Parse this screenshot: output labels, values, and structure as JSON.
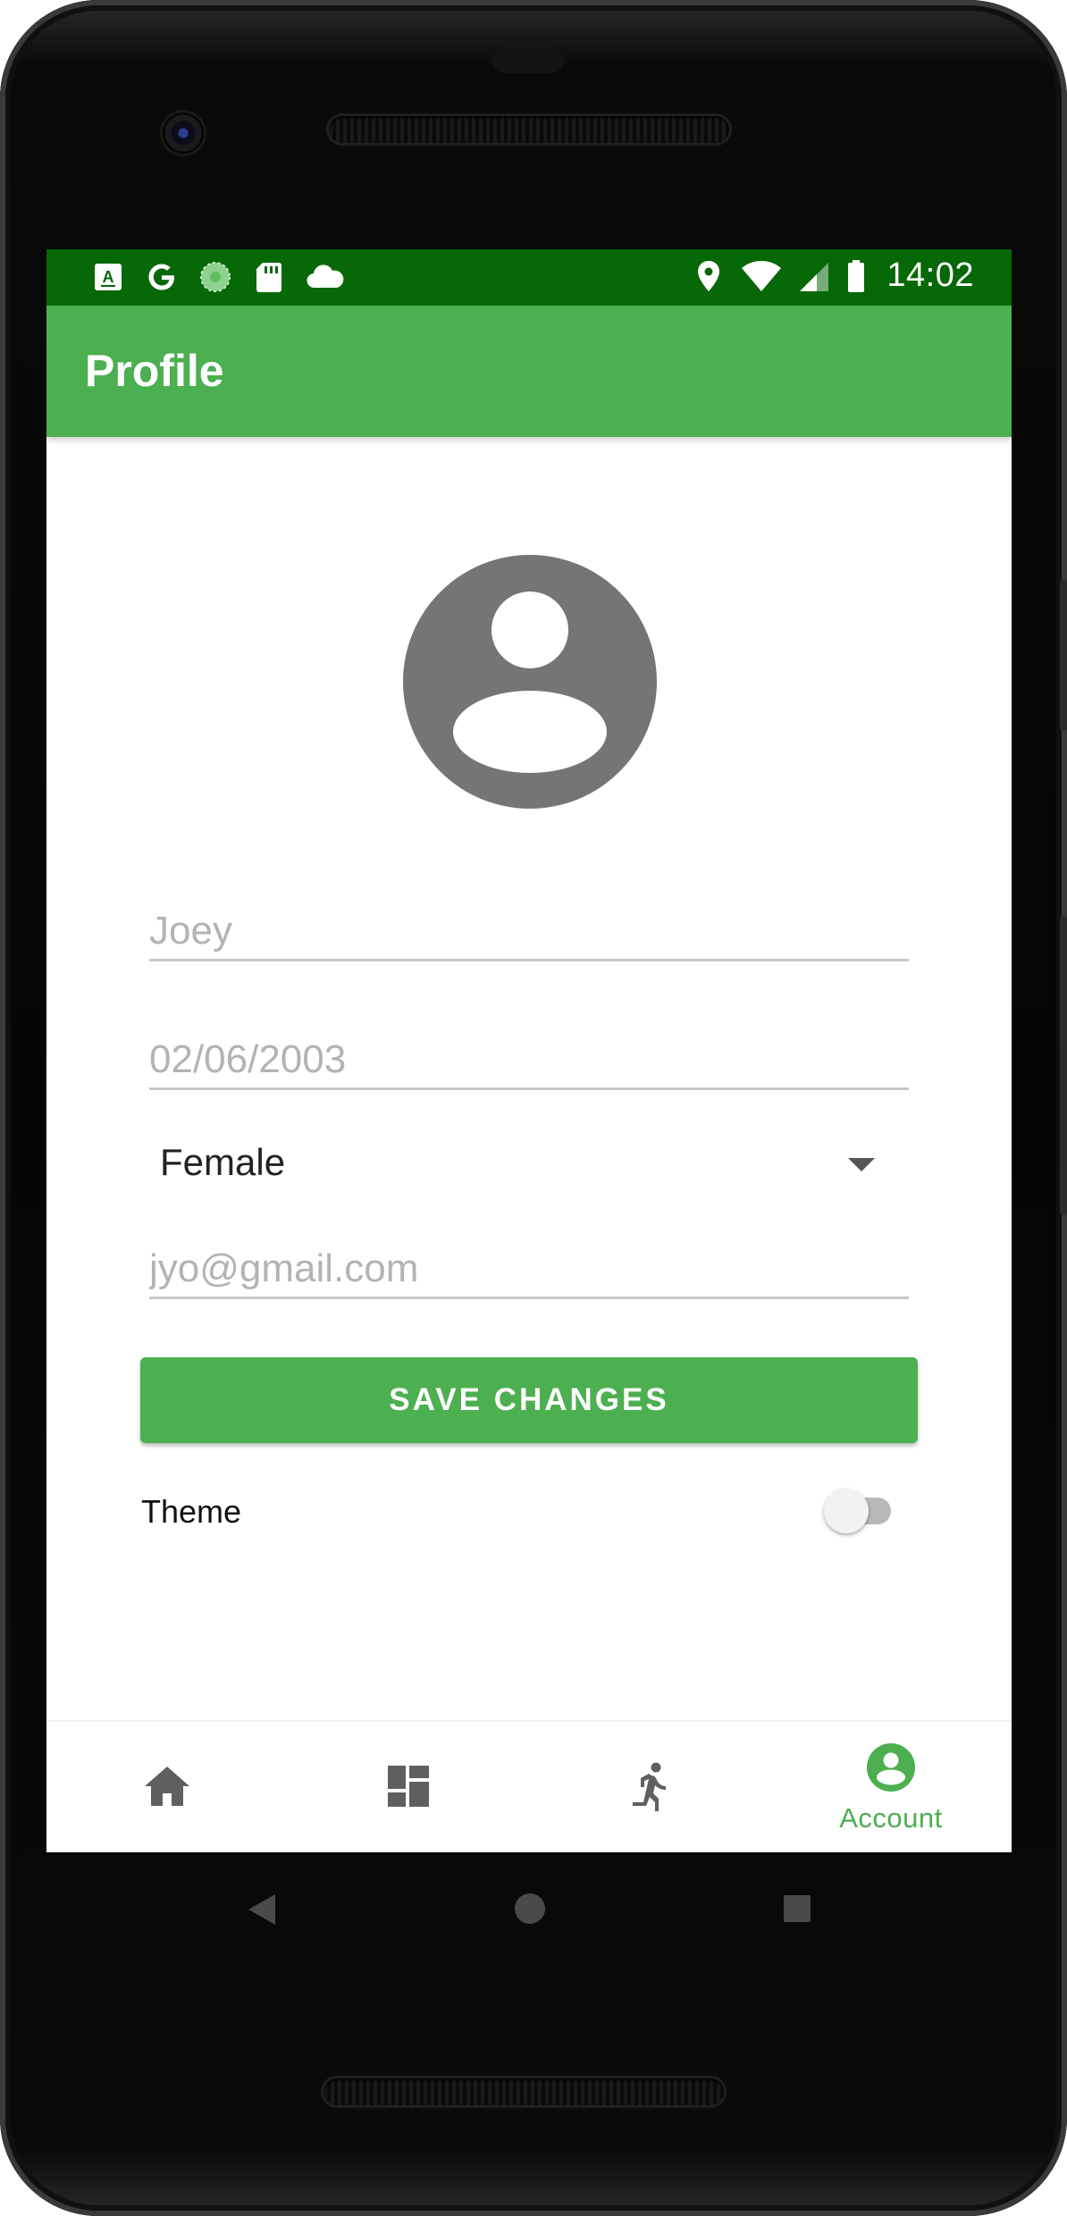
{
  "status_bar": {
    "left_icons": [
      "keyboard-icon",
      "google-icon",
      "sync-icon",
      "sd-card-icon",
      "cloud-icon"
    ],
    "right_icons": [
      "location-icon",
      "wifi-icon",
      "signal-icon",
      "battery-icon"
    ],
    "time": "14:02"
  },
  "app_bar": {
    "title": "Profile"
  },
  "profile": {
    "avatar_icon": "account-circle-icon",
    "name_placeholder": "Joey",
    "dob_placeholder": "02/06/2003",
    "gender": {
      "selected": "Female",
      "icon": "dropdown-arrow-icon"
    },
    "email_placeholder": "jyo@gmail.com",
    "save_label": "SAVE CHANGES",
    "theme": {
      "label": "Theme",
      "enabled": false
    }
  },
  "bottom_nav": {
    "items": [
      {
        "id": "home",
        "icon": "home-icon",
        "label": "",
        "active": false
      },
      {
        "id": "dashboard",
        "icon": "dashboard-icon",
        "label": "",
        "active": false
      },
      {
        "id": "activity",
        "icon": "running-icon",
        "label": "",
        "active": false
      },
      {
        "id": "account",
        "icon": "account-icon",
        "label": "Account",
        "active": true
      }
    ]
  },
  "system_nav": [
    "back-icon",
    "home-circle-icon",
    "recents-icon"
  ],
  "colors": {
    "status_bar": "#066806",
    "primary": "#4caf50",
    "icon_grey": "#757575",
    "nav_icon_grey": "#5f5f5f"
  }
}
